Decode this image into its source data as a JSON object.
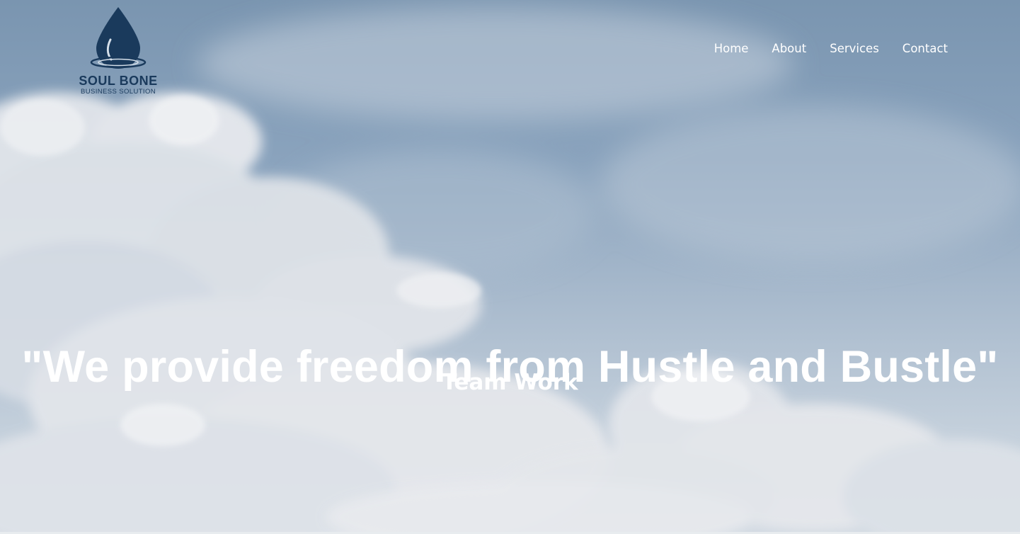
{
  "brand": {
    "name": "SOUL BONE",
    "tagline": "BUSINESS SOLUTION",
    "logo_icon": "water-drop-icon",
    "color": "#1a3a5c"
  },
  "nav": {
    "items": [
      {
        "label": "Home"
      },
      {
        "label": "About"
      },
      {
        "label": "Services"
      },
      {
        "label": "Contact"
      }
    ]
  },
  "hero": {
    "headline": "\"We provide freedom from Hustle and Bustle\"",
    "subheadline": "Team Work",
    "background": "sky-clouds"
  }
}
